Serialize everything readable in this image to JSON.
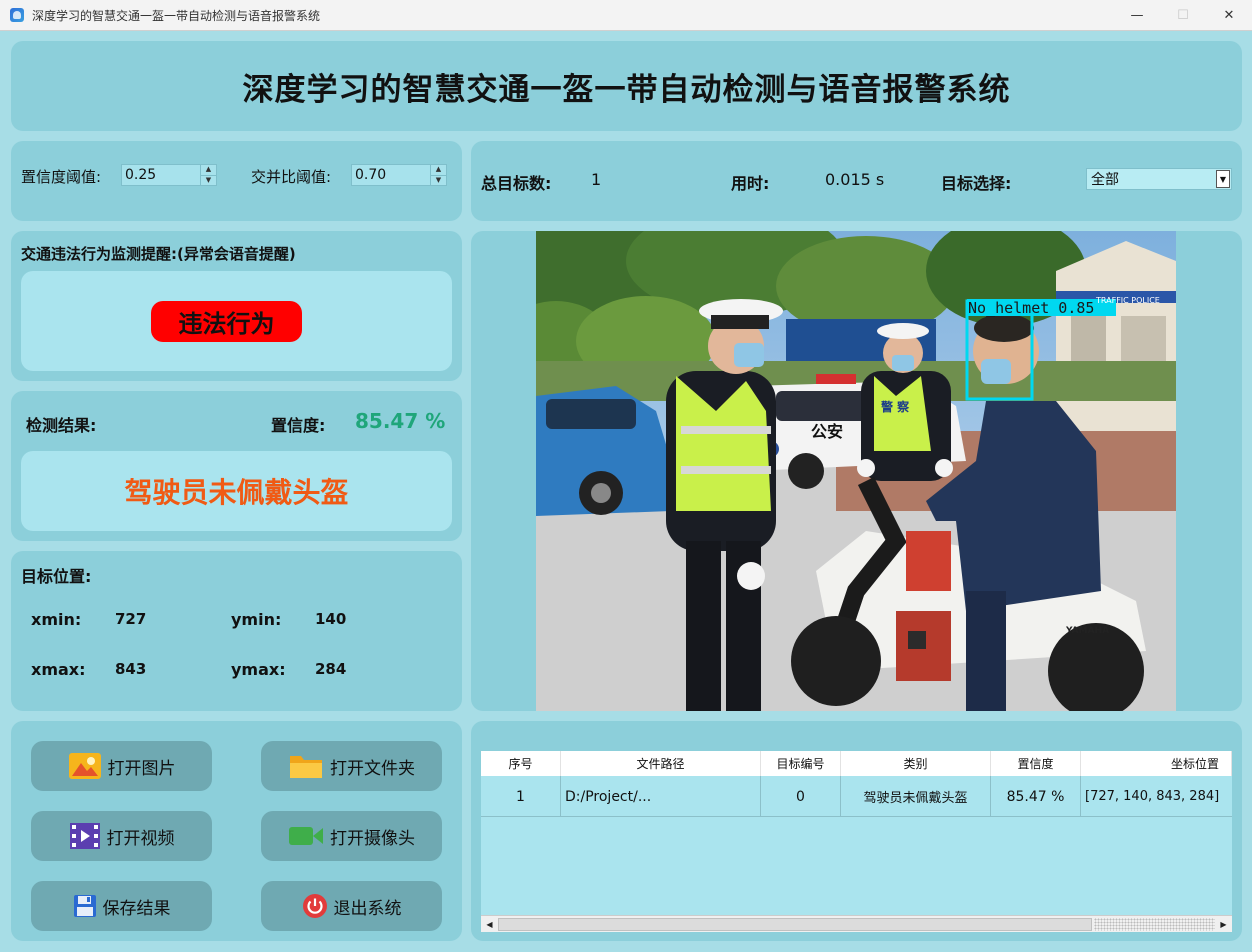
{
  "window": {
    "title": "深度学习的智慧交通一盔一带自动检测与语音报警系统",
    "minimize": "—",
    "maximize": "☐",
    "close": "✕"
  },
  "header": {
    "title": "深度学习的智慧交通一盔一带自动检测与语音报警系统"
  },
  "params": {
    "confidence_label": "置信度阈值:",
    "confidence_value": "0.25",
    "iou_label": "交并比阈值:",
    "iou_value": "0.70"
  },
  "stats": {
    "total_label": "总目标数:",
    "total_value": "1",
    "time_label": "用时:",
    "time_value": "0.015 s",
    "target_label": "目标选择:",
    "target_value": "全部"
  },
  "alert": {
    "title": "交通违法行为监测提醒:(异常会语音提醒)",
    "badge": "违法行为"
  },
  "result": {
    "label": "检测结果:",
    "conf_label": "置信度:",
    "conf_value": "85.47 %",
    "text": "驾驶员未佩戴头盔"
  },
  "position": {
    "label": "目标位置:",
    "xmin_label": "xmin:",
    "xmin": "727",
    "ymin_label": "ymin:",
    "ymin": "140",
    "xmax_label": "xmax:",
    "xmax": "843",
    "ymax_label": "ymax:",
    "ymax": "284"
  },
  "detection": {
    "box_label": "No_helmet  0.85"
  },
  "scene_text": {
    "police_car": "公安",
    "vest": "警 察",
    "sign": "TRAFFIC POLICE",
    "scooter": "YAMAHA"
  },
  "buttons": {
    "open_image": "打开图片",
    "open_folder": "打开文件夹",
    "open_video": "打开视频",
    "open_camera": "打开摄像头",
    "save": "保存结果",
    "exit": "退出系统"
  },
  "table": {
    "headers": [
      "序号",
      "文件路径",
      "目标编号",
      "类别",
      "置信度",
      "坐标位置"
    ],
    "rows": [
      [
        "1",
        "D:/Project/...",
        "0",
        "驾驶员未佩戴头盔",
        "85.47 %",
        "[727, 140, 843, 284]"
      ]
    ]
  },
  "colors": {
    "background": "#a7dde6",
    "panel": "#8ccfda",
    "alarm": "#ff0000",
    "result_text": "#f05a14",
    "confidence": "#1fa67a",
    "detection_box": "#00d8f0"
  }
}
